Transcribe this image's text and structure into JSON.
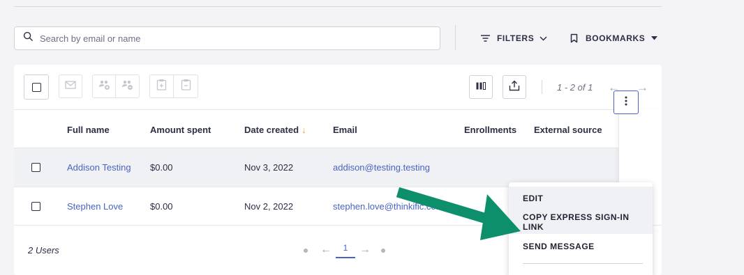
{
  "search": {
    "placeholder": "Search by email or name"
  },
  "toolbar": {
    "filters_label": "FILTERS",
    "bookmarks_label": "BOOKMARKS"
  },
  "table": {
    "pagination_label": "1 - 2 of 1",
    "columns": [
      "Full name",
      "Amount spent",
      "Date created",
      "Email",
      "Enrollments",
      "External source"
    ],
    "sort_indicator": "↓",
    "rows": [
      {
        "name": "Addison Testing",
        "amount": "$0.00",
        "date": "Nov 3, 2022",
        "email": "addison@testing.testing"
      },
      {
        "name": "Stephen Love",
        "amount": "$0.00",
        "date": "Nov 2, 2022",
        "email": "stephen.love@thinkific.com"
      }
    ],
    "footer": {
      "count_label": "2 Users",
      "current_page": "1"
    }
  },
  "row_menu": {
    "items": [
      "EDIT",
      "COPY EXPRESS SIGN-IN LINK",
      "SEND MESSAGE"
    ]
  },
  "colors": {
    "accent": "#4a62c4",
    "sort_arrow": "#e0a020",
    "annotation_arrow": "#0e8f6c",
    "page_background": "#f4f4f6"
  },
  "icons": {
    "search": "search-icon",
    "filters": "filter-lines-icon",
    "bookmarks": "bookmark-icon",
    "columns": "columns-icon",
    "export": "export-upload-icon",
    "row_actions": "kebab-menu-icon"
  }
}
